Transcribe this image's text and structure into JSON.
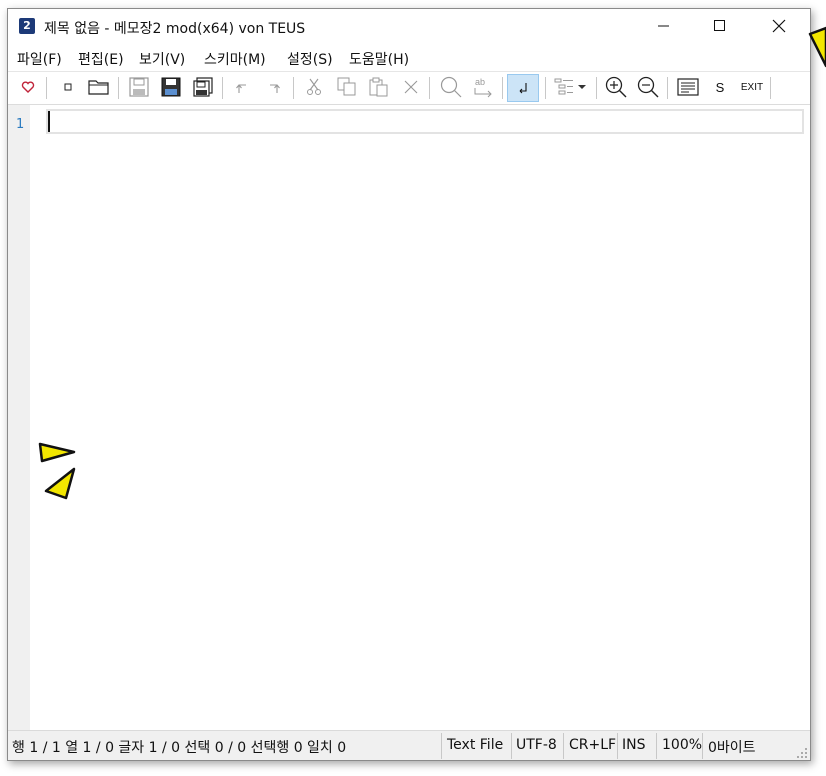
{
  "window": {
    "app_icon": "2",
    "title": "제목 없음 - 메모장2 mod(x64) von TEUS"
  },
  "menu": {
    "items": [
      "파일(F)",
      "편집(E)",
      "보기(V)",
      "스키마(M)",
      "설정(S)",
      "도움말(H)"
    ]
  },
  "toolbar": {
    "buttons": [
      "favorite-icon",
      "new-file-icon",
      "open-folder-icon",
      "save-icon",
      "save-as-icon",
      "save-all-icon",
      "undo-icon",
      "redo-icon",
      "cut-icon",
      "copy-icon",
      "paste-icon",
      "delete-icon",
      "find-icon",
      "replace-icon",
      "word-wrap-icon",
      "scheme-dropdown-icon",
      "zoom-in-icon",
      "zoom-out-icon",
      "view-icon",
      "settings-icon",
      "exit-icon"
    ],
    "settings_label": "S",
    "exit_label": "EXIT",
    "word_wrap_active": true
  },
  "editor": {
    "line_numbers": [
      "1"
    ],
    "content": ""
  },
  "status": {
    "position": "행 1 / 1  열 1 / 0  글자 1 / 0  선택 0 / 0  선택행 0  일치 0",
    "file_type": "Text File",
    "encoding": "UTF-8",
    "line_ending": "CR+LF",
    "mode": "INS",
    "zoom": "100%",
    "size": "0바이트"
  },
  "colors": {
    "accent": "#1d3a78",
    "line_number": "#2b7bc0",
    "active_button_bg": "#cce4f7",
    "pointer_fill": "#f2e600"
  }
}
